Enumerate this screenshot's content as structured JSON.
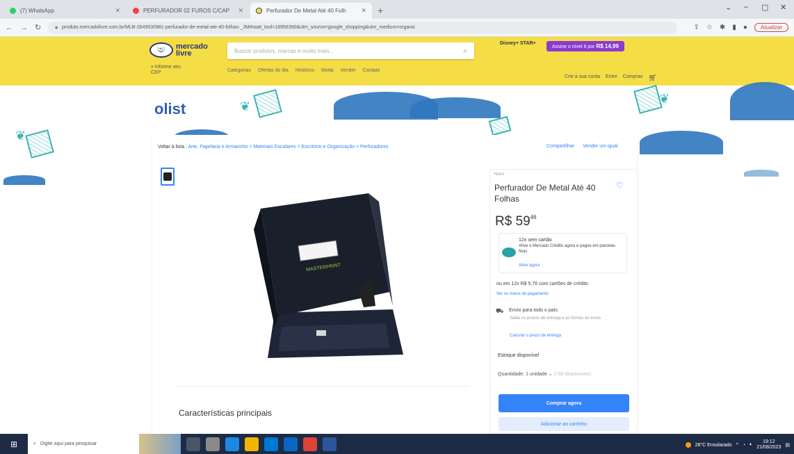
{
  "browser": {
    "tabs": [
      {
        "label": "(7) WhatsApp",
        "color": "#25d366"
      },
      {
        "label": "PERFURADOR 02 FUROS C/CAP",
        "color": "#e44"
      },
      {
        "label": "Perfurador De Metal Até 40 Folh",
        "color": "#f4dd45"
      }
    ],
    "new_tab": "+",
    "url": "produto.mercadolivre.com.br/MLB-2649530981-perfurador-de-metal-ate-40-folhas-_JM#matt_tool=18956390&utm_source=google_shopping&utm_medium=organic",
    "update_label": "Atualizar"
  },
  "header": {
    "logo_line1": "mercado",
    "logo_line2": "livre",
    "cep_line1": "Informe seu",
    "cep_line2": "CEP",
    "search_placeholder": "Buscar produtos, marcas e muito mais...",
    "nav": [
      "Categorias",
      "Ofertas do dia",
      "Histórico",
      "Moda",
      "Vender",
      "Contato"
    ],
    "disney": "Disney+ STAR+",
    "promo_text": "Assine o nível 6 por",
    "promo_price": "R$ 14,99",
    "account": [
      "Crie a sua conta",
      "Entre",
      "Compras"
    ]
  },
  "store": {
    "name": "olist"
  },
  "breadcrumb": {
    "back": "Voltar à lista",
    "path": "Arte, Papelaria e Armarinho > Materiais Escolares > Escritório e Organização > Perfuradores"
  },
  "share": [
    "Compartilhar",
    "Vender um igual"
  ],
  "product": {
    "brand_label": "MASTERPRINT",
    "condition": "Novo",
    "title": "Perfurador De Metal Até 40 Folhas",
    "price_main": "R$ 59",
    "price_cents": "46",
    "credit_line1": "12x sem cartão",
    "credit_line2": "Ative o Mercado Crédito agora e pague em parcelas fixas",
    "credit_link": "Ative agora",
    "installments": "ou em 12x R$ 5,76 com cartões de crédito",
    "payment_link": "Ver os meios de pagamento",
    "shipping_title": "Envio para todo o país",
    "shipping_sub": "Saiba os prazos de entrega e as formas de envio.",
    "shipping_link": "Calcular o prazo de entrega",
    "stock": "Estoque disponível",
    "quantity": "Quantidade: 1 unidade",
    "quantity_note": "(+50 disponíveis)",
    "buy_label": "Comprar agora",
    "cart_label": "Adicionar ao carrinho",
    "features_title": "Características principais"
  },
  "taskbar": {
    "search_placeholder": "Digite aqui para pesquisar",
    "weather": "28°C Ensolarado",
    "time": "19:12",
    "date": "21/08/2023"
  }
}
